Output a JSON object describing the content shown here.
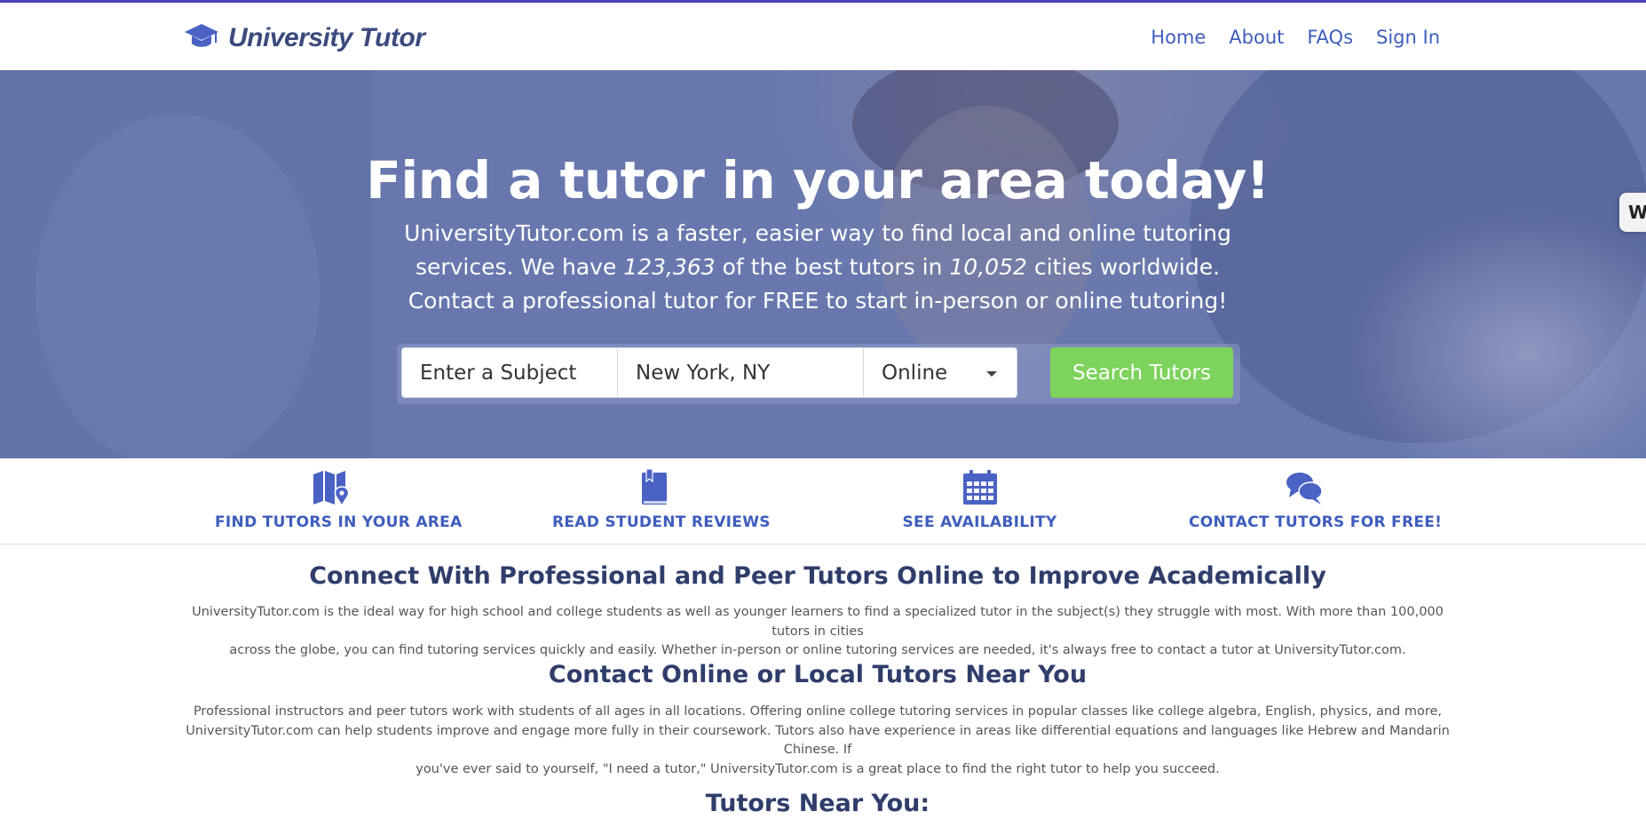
{
  "colors": {
    "brand": "#3e5dbd",
    "heading": "#2f3d6b",
    "cta": "#7dd35b",
    "top_border": "#4b3fb8"
  },
  "header": {
    "logo_icon": "graduation-cap-icon",
    "brand": "University Tutor",
    "nav": [
      "Home",
      "About",
      "FAQs",
      "Sign In"
    ]
  },
  "hero": {
    "title": "Find a tutor in your area today!",
    "sub_1": "UniversityTutor.com is a faster, easier way to find local and online tutoring",
    "sub_2a": "services. We have ",
    "tutor_count": "123,363",
    "sub_2b": " of the best tutors in ",
    "city_count": "10,052",
    "sub_2c": " cities worldwide.",
    "sub_3": "Contact a professional tutor for FREE to start in-person or online tutoring!",
    "subject_placeholder": "Enter a Subject",
    "location_value": "New York, NY",
    "mode_value": "Online",
    "search_button": "Search Tutors",
    "side_tab": "W"
  },
  "features": [
    {
      "icon": "map-pin-icon",
      "label": "FIND TUTORS IN YOUR AREA"
    },
    {
      "icon": "bookmark-book-icon",
      "label": "READ STUDENT REVIEWS"
    },
    {
      "icon": "calendar-icon",
      "label": "SEE AVAILABILITY"
    },
    {
      "icon": "chat-bubbles-icon",
      "label": "CONTACT TUTORS FOR FREE!"
    }
  ],
  "sections": {
    "connect": {
      "title": "Connect With Professional and Peer Tutors Online to Improve Academically",
      "body_1": "UniversityTutor.com is the ideal way for high school and college students as well as younger learners to find a specialized tutor in the subject(s) they struggle with most. With more than 100,000 tutors in cities",
      "body_2": "across the globe, you can find tutoring services quickly and easily. Whether in-person or online tutoring services are needed, it's always free to contact a tutor at UniversityTutor.com."
    },
    "contact": {
      "title": "Contact Online or Local Tutors Near You",
      "body_1": "Professional instructors and peer tutors work with students of all ages in all locations. Offering online college tutoring services in popular classes like college algebra, English, physics, and more,",
      "body_2": "UniversityTutor.com can help students improve and engage more fully in their coursework. Tutors also have experience in areas like differential equations and languages like Hebrew and Mandarin Chinese. If",
      "body_3": "you've ever said to yourself, \"I need a tutor,\" UniversityTutor.com is a great place to find the right tutor to help you succeed."
    },
    "near": {
      "title": "Tutors Near You:"
    }
  }
}
